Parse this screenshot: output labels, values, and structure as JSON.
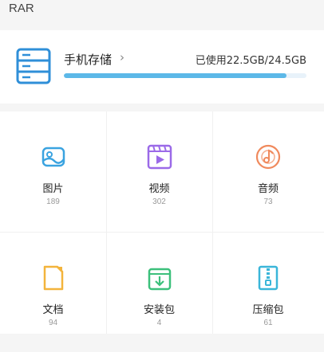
{
  "header": {
    "title": "RAR"
  },
  "storage": {
    "label": "手机存储",
    "chevron": "›",
    "usage_text": "已使用22.5GB/24.5GB",
    "used_fraction": 0.918,
    "bar_color": "#5cb8e8",
    "icon": "server-storage-icon",
    "icon_color": "#2f8fd8"
  },
  "categories": [
    {
      "label": "图片",
      "count": "189",
      "icon": "image-icon",
      "color": "#3aa3e0"
    },
    {
      "label": "视频",
      "count": "302",
      "icon": "video-icon",
      "color": "#9b6ae8"
    },
    {
      "label": "音频",
      "count": "73",
      "icon": "music-disc-icon",
      "color": "#f08a5d"
    },
    {
      "label": "文档",
      "count": "94",
      "icon": "document-icon",
      "color": "#f3b43c"
    },
    {
      "label": "安装包",
      "count": "4",
      "icon": "install-package-icon",
      "color": "#3cc07b"
    },
    {
      "label": "压缩包",
      "count": "61",
      "icon": "zip-file-icon",
      "color": "#3ab6d9"
    }
  ]
}
